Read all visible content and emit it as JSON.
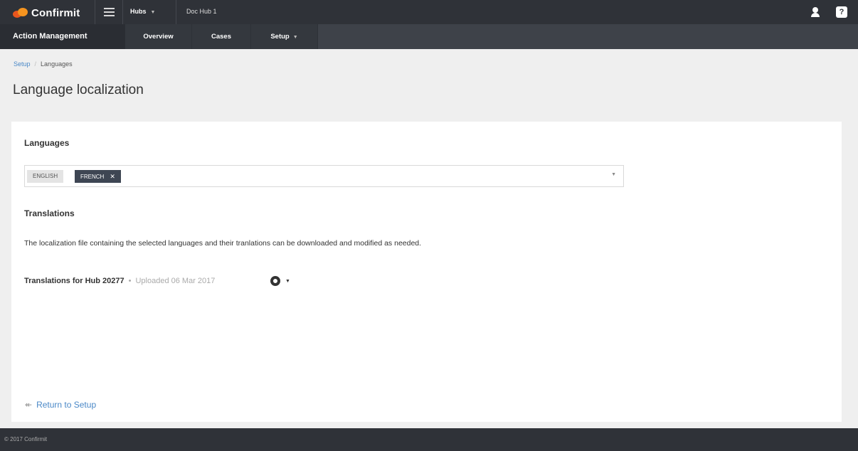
{
  "header": {
    "brand": "Confirmit",
    "hubs_menu": "Hubs",
    "hub_name": "Doc Hub 1"
  },
  "subnav": {
    "app_name": "Action Management",
    "tabs": [
      {
        "label": "Overview"
      },
      {
        "label": "Cases"
      },
      {
        "label": "Setup"
      }
    ]
  },
  "breadcrumb": {
    "root": "Setup",
    "separator": "/",
    "current": "Languages"
  },
  "page": {
    "title": "Language localization"
  },
  "languages": {
    "heading": "Languages",
    "selected": [
      {
        "label": "ENGLISH",
        "removable": false
      },
      {
        "label": "FRENCH",
        "removable": true
      }
    ],
    "remove_glyph": "✕"
  },
  "translations": {
    "heading": "Translations",
    "description": "The localization file containing the selected languages and their tranlations can be downloaded and modified as needed.",
    "file_name": "Translations for Hub 20277",
    "separator": "•",
    "uploaded": "Uploaded 06 Mar 2017"
  },
  "return_link": {
    "label": "Return to Setup"
  },
  "footer": {
    "copyright": "© 2017 Confirmit"
  },
  "icons": {
    "menu": "hamburger-menu-icon",
    "user": "user-icon",
    "help": "help-icon",
    "gear": "gear-icon",
    "back": "back-arrow-icon"
  },
  "colors": {
    "topbar": "#2f3238",
    "subnav": "#3e4249",
    "link": "#4a88c7",
    "chip_selected": "#3e4653",
    "brand_orange": "#f5941f"
  }
}
